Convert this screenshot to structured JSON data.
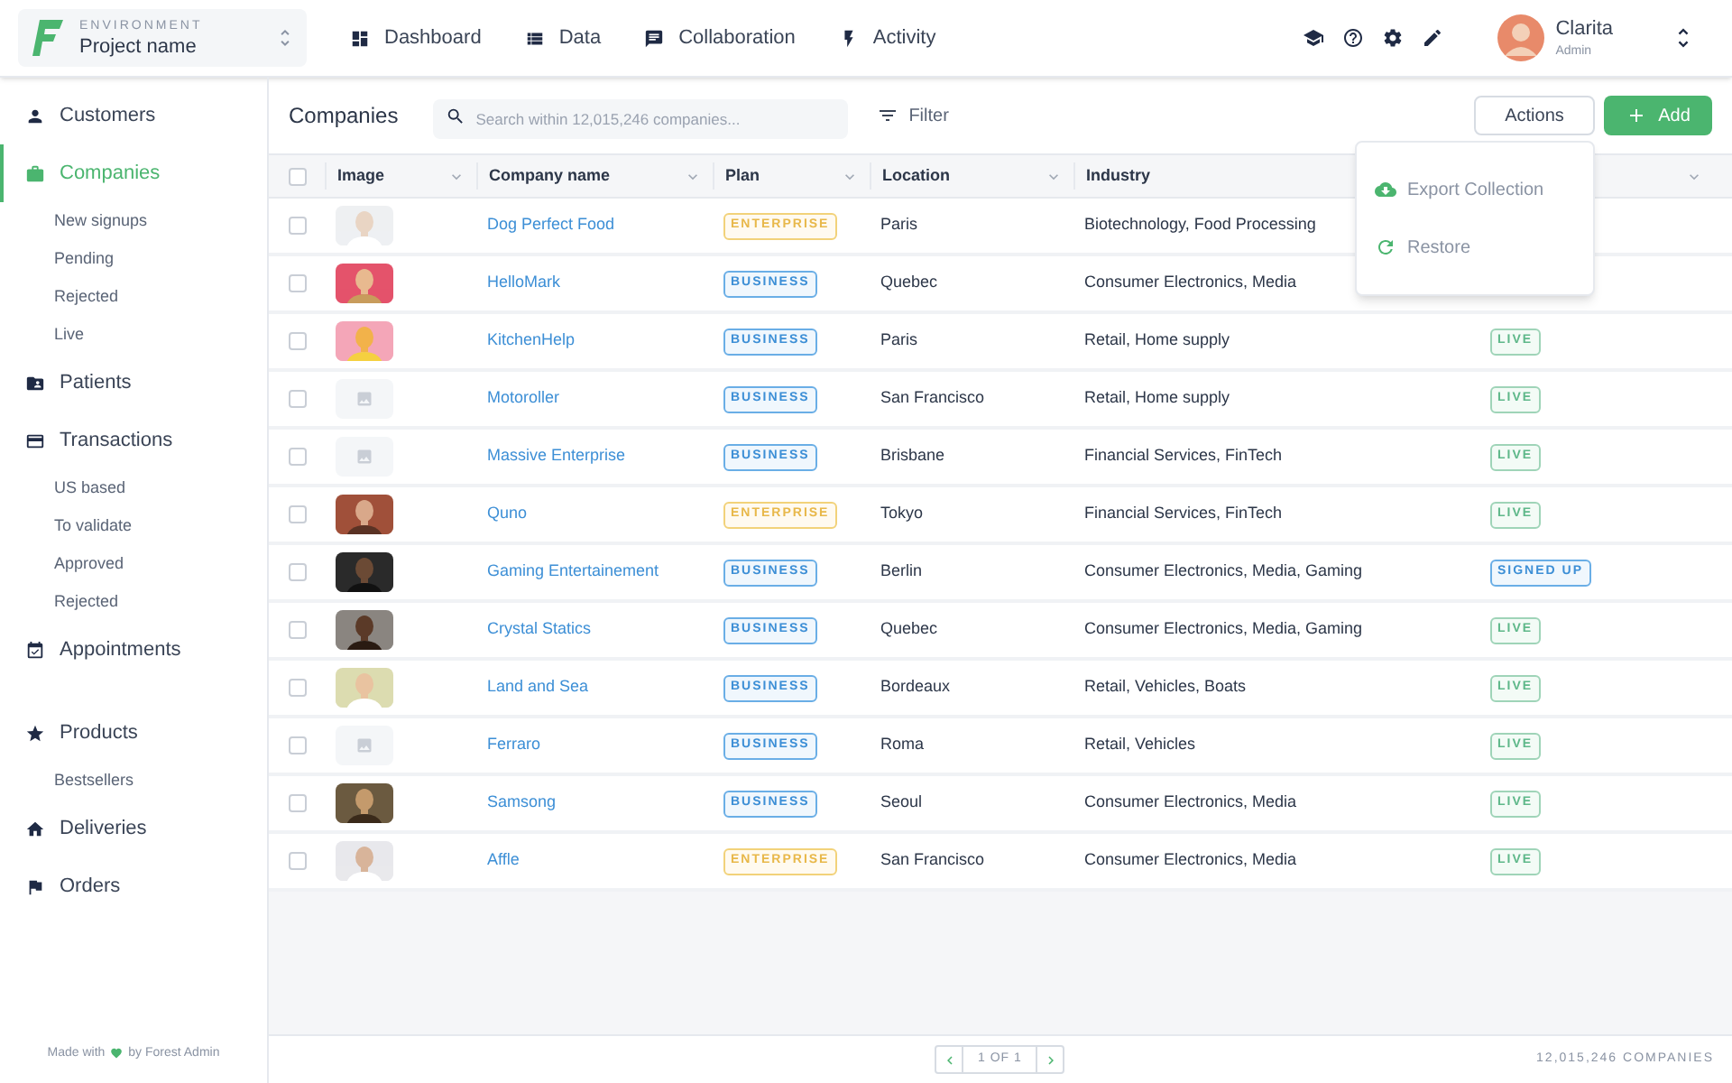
{
  "header": {
    "environment_label": "ENVIRONMENT",
    "project": "Project name",
    "nav": [
      {
        "label": "Dashboard",
        "selected": false
      },
      {
        "label": "Data",
        "selected": false
      },
      {
        "label": "Collaboration",
        "selected": false
      },
      {
        "label": "Activity",
        "selected": false
      }
    ],
    "user": {
      "name": "Clarita",
      "role": "Admin"
    }
  },
  "sidebar": {
    "items": [
      {
        "label": "Customers",
        "selected": false
      },
      {
        "label": "Companies",
        "selected": true,
        "children": [
          {
            "label": "New signups",
            "selected": false
          },
          {
            "label": "Pending",
            "selected": false
          },
          {
            "label": "Rejected",
            "selected": false
          },
          {
            "label": "Live",
            "selected": false
          }
        ]
      },
      {
        "label": "Patients",
        "selected": false
      },
      {
        "label": "Transactions",
        "selected": false,
        "children": [
          {
            "label": "US based",
            "selected": false
          },
          {
            "label": "To validate",
            "selected": false
          },
          {
            "label": "Approved",
            "selected": false
          },
          {
            "label": "Rejected",
            "selected": false
          }
        ]
      },
      {
        "label": "Appointments",
        "selected": false
      },
      {
        "label": "Products",
        "selected": false,
        "children": [
          {
            "label": "Bestsellers",
            "selected": false
          }
        ]
      },
      {
        "label": "Deliveries",
        "selected": false
      },
      {
        "label": "Orders",
        "selected": false
      }
    ],
    "footer_before": "Made with",
    "footer_after": "by Forest Admin"
  },
  "toolbar": {
    "title": "Companies",
    "search": {
      "placeholder": "Search within 12,015,246 companies..."
    },
    "filter": "Filter",
    "actions": "Actions",
    "add": "Add"
  },
  "actions_menu": [
    {
      "label": "Export Collection"
    },
    {
      "label": "Restore"
    }
  ],
  "table": {
    "select_all_checked": false,
    "columns": [
      "Image",
      "Company name",
      "Plan",
      "Location",
      "Industry"
    ],
    "rows": [
      {
        "checked": false,
        "name": "Dog Perfect Food",
        "plan": {
          "label": "ENTERPRISE",
          "kind": "enterprise"
        },
        "location": "Paris",
        "industry": "Biotechnology, Food Processing"
      },
      {
        "checked": false,
        "name": "HelloMark",
        "plan": {
          "label": "BUSINESS",
          "kind": "business"
        },
        "location": "Quebec",
        "industry": "Consumer Electronics, Media"
      },
      {
        "checked": false,
        "name": "KitchenHelp",
        "plan": {
          "label": "BUSINESS",
          "kind": "business"
        },
        "location": "Paris",
        "industry": "Retail, Home supply",
        "status": {
          "label": "LIVE",
          "kind": "live"
        }
      },
      {
        "checked": false,
        "image": {
          "kind": "placeholder"
        },
        "name": "Motoroller",
        "plan": {
          "label": "BUSINESS",
          "kind": "business"
        },
        "location": "San Francisco",
        "industry": "Retail, Home supply",
        "status": {
          "label": "LIVE",
          "kind": "live"
        }
      },
      {
        "checked": false,
        "image": {
          "kind": "placeholder"
        },
        "name": "Massive Enterprise",
        "plan": {
          "label": "BUSINESS",
          "kind": "business"
        },
        "location": "Brisbane",
        "industry": "Financial Services, FinTech",
        "status": {
          "label": "LIVE",
          "kind": "live"
        }
      },
      {
        "checked": false,
        "name": "Quno",
        "plan": {
          "label": "ENTERPRISE",
          "kind": "enterprise"
        },
        "location": "Tokyo",
        "industry": "Financial Services, FinTech",
        "status": {
          "label": "LIVE",
          "kind": "live"
        }
      },
      {
        "checked": false,
        "name": "Gaming Entertainement",
        "plan": {
          "label": "BUSINESS",
          "kind": "business"
        },
        "location": "Berlin",
        "industry": "Consumer Electronics, Media, Gaming",
        "status": {
          "label": "SIGNED UP",
          "kind": "signed_up"
        }
      },
      {
        "checked": false,
        "name": "Crystal Statics",
        "plan": {
          "label": "BUSINESS",
          "kind": "business"
        },
        "location": "Quebec",
        "industry": "Consumer Electronics, Media, Gaming",
        "status": {
          "label": "LIVE",
          "kind": "live"
        }
      },
      {
        "checked": false,
        "name": "Land and Sea",
        "plan": {
          "label": "BUSINESS",
          "kind": "business"
        },
        "location": "Bordeaux",
        "industry": "Retail, Vehicles, Boats",
        "status": {
          "label": "LIVE",
          "kind": "live"
        }
      },
      {
        "checked": false,
        "image": {
          "kind": "placeholder"
        },
        "name": "Ferraro",
        "plan": {
          "label": "BUSINESS",
          "kind": "business"
        },
        "location": "Roma",
        "industry": "Retail, Vehicles",
        "status": {
          "label": "LIVE",
          "kind": "live"
        }
      },
      {
        "checked": false,
        "name": "Samsong",
        "plan": {
          "label": "BUSINESS",
          "kind": "business"
        },
        "location": "Seoul",
        "industry": "Consumer Electronics, Media",
        "status": {
          "label": "LIVE",
          "kind": "live"
        }
      },
      {
        "checked": false,
        "name": "Affle",
        "plan": {
          "label": "ENTERPRISE",
          "kind": "enterprise"
        },
        "location": "San Francisco",
        "industry": "Consumer Electronics, Media",
        "status": {
          "label": "LIVE",
          "kind": "live"
        }
      }
    ]
  },
  "footer": {
    "page": "1 OF 1",
    "count": "12,015,246 COMPANIES"
  }
}
